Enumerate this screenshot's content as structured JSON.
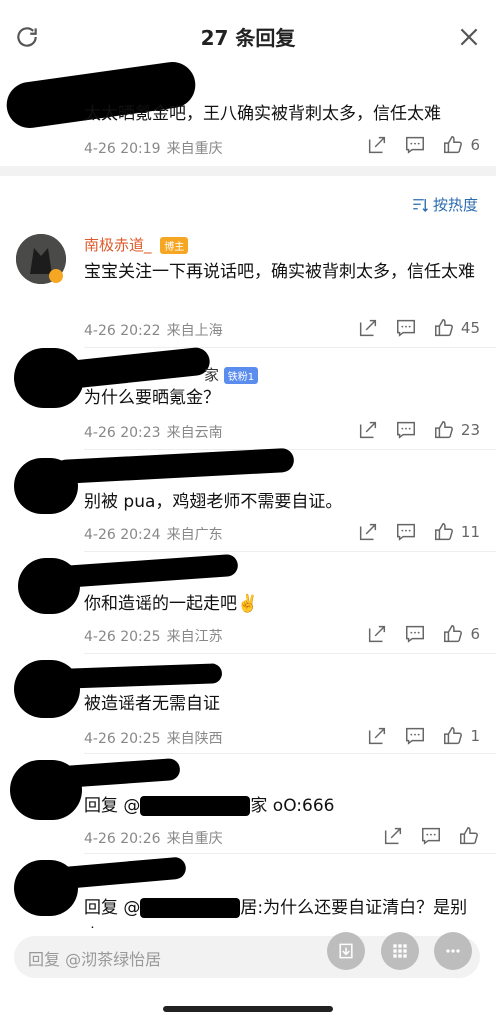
{
  "header": {
    "title": "27 条回复"
  },
  "pinned": {
    "text": "太太晒氪金吧，王八确实被背刺太多，信任太难",
    "time": "4-26 20:19",
    "location": "来自重庆",
    "likes": "6"
  },
  "sort": {
    "label": "按热度"
  },
  "comments": [
    {
      "name": "南极赤道_",
      "badge": "博主",
      "text": "宝宝关注一下再说话吧，确实被背刺太多，信任太难",
      "time": "4-26 20:22",
      "location": "来自上海",
      "likes": "45"
    },
    {
      "name_partial": "家",
      "badge": "铁粉1",
      "text": "为什么要晒氪金？",
      "time": "4-26 20:23",
      "location": "来自云南",
      "likes": "23"
    },
    {
      "text": "别被 pua，鸡翅老师不需要自证。",
      "time": "4-26 20:24",
      "location": "来自广东",
      "likes": "11"
    },
    {
      "text": "你和造谣的一起走吧✌️",
      "time": "4-26 20:25",
      "location": "来自江苏",
      "likes": "6"
    },
    {
      "text": "被造谣者无需自证",
      "time": "4-26 20:25",
      "location": "来自陕西",
      "likes": "1"
    },
    {
      "text_prefix": "回复 @",
      "text_suffix": "家 oO:666",
      "time": "4-26 20:26",
      "location": "来自重庆",
      "likes": ""
    },
    {
      "text_prefix": "回复 @",
      "text_suffix": "居:为什么还要自证清白？是别人",
      "text_line2": "…"
    }
  ],
  "reply_bar": {
    "placeholder": "回复 @沏茶绿怡居"
  }
}
